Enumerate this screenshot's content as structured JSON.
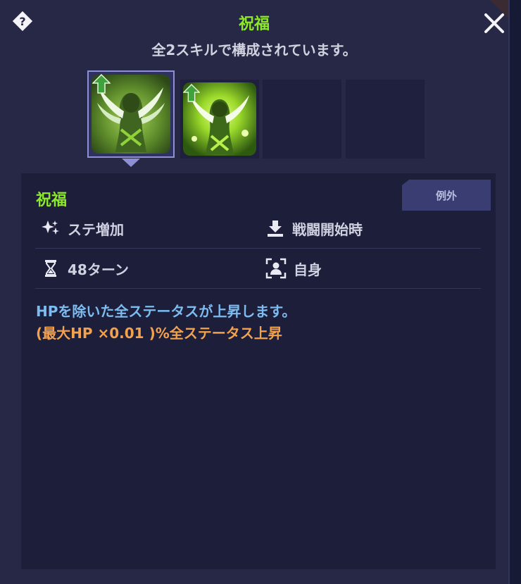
{
  "header": {
    "title": "祝福",
    "subtitle": "全2スキルで構成されています。",
    "help_icon": "question-diamond-icon",
    "close_icon": "close-x-icon"
  },
  "skills": [
    {
      "name": "blessing-winged-figure",
      "selected": true
    },
    {
      "name": "blessing-winged-figure-glow",
      "selected": false
    },
    {
      "name": "empty",
      "selected": false
    },
    {
      "name": "empty",
      "selected": false
    }
  ],
  "detail": {
    "name": "祝福",
    "tag": "例外",
    "effect_type": {
      "icon": "stat-sparkle-icon",
      "label": "ステ増加"
    },
    "timing": {
      "icon": "download-tray-icon",
      "label": "戦闘開始時"
    },
    "duration": {
      "icon": "hourglass-icon",
      "label": "48ターン"
    },
    "target": {
      "icon": "self-target-icon",
      "label": "自身"
    },
    "description": "HPを除いた全ステータスが上昇します。",
    "formula": "(最大HP ×0.01 )%全ステータス上昇"
  },
  "colors": {
    "title_green": "#8ee82a",
    "description_blue": "#7dbcf0",
    "formula_orange": "#f3a14c",
    "panel_bg": "#262846",
    "detail_bg": "#1c1e3a"
  }
}
